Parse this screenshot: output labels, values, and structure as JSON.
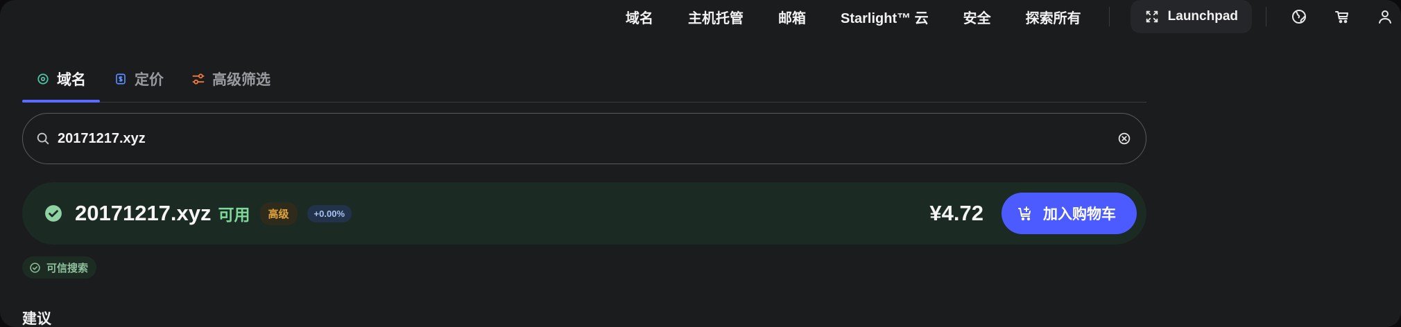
{
  "nav": {
    "links": [
      "域名",
      "主机托管",
      "邮箱",
      "Starlight™ 云",
      "安全",
      "探索所有"
    ],
    "launchpad": "Launchpad",
    "icons": [
      "globe-icon",
      "cart-icon",
      "account-icon"
    ]
  },
  "tabs": [
    {
      "label": "域名",
      "icon": "domain-icon",
      "active": true
    },
    {
      "label": "定价",
      "icon": "pricing-icon",
      "active": false
    },
    {
      "label": "高级筛选",
      "icon": "filter-icon",
      "active": false
    }
  ],
  "search": {
    "value": "20171217.xyz",
    "placeholder": ""
  },
  "result": {
    "domain": "20171217.xyz",
    "status": "可用",
    "tier": "高级",
    "change": "+0.00%",
    "price": "¥4.72",
    "add_to_cart": "加入购物车"
  },
  "trusted_search": "可信搜索",
  "section_title": "建议",
  "colors": {
    "accent": "#4c5bff",
    "available_green": "#7dd89a",
    "premium_amber": "#e2a43a"
  }
}
